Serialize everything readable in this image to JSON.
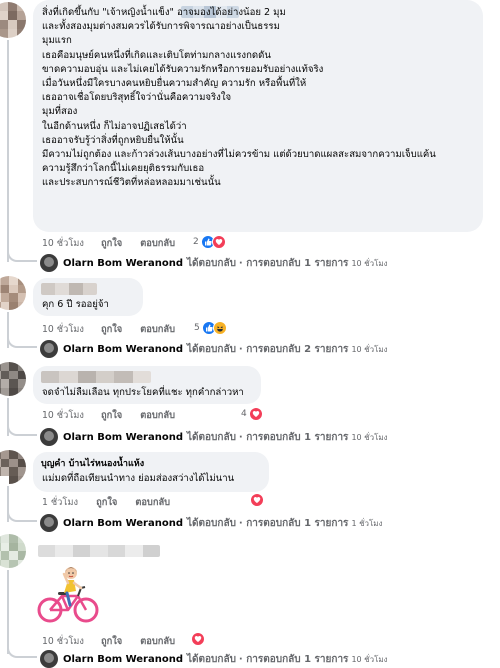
{
  "colors": {
    "bubble": "#f0f2f5",
    "meta_text": "#65676b",
    "like_blue": "#1877f2",
    "heart_red": "#f33e58",
    "haha_yellow": "#f7b125"
  },
  "comments": [
    {
      "lines": [
        "สิ่งที่เกิดขึ้นกับ \"เจ้าหญิงน้ำแข็ง\" อาจมองได้อย่างน้อย 2 มุม",
        "และทั้งสองมุมต่างสมควรได้รับการพิจารณาอย่างเป็นธรรม",
        "",
        "มุมแรก",
        "เธอคือมนุษย์คนหนึ่งที่เกิดและเติบโตท่ามกลางแรงกดดัน",
        "ขาดความอบอุ่น และไม่เคยได้รับความรักหรือการยอมรับอย่างแท้จริง",
        "เมื่อวันหนึ่งมีใครบางคนหยิบยื่นความสำคัญ ความรัก หรือพื้นที่ให้",
        "เธออาจเชื่อโดยบริสุทธิ์ใจว่านั่นคือความจริงใจ",
        "",
        "มุมที่สอง",
        "ในอีกด้านหนึ่ง ก็ไม่อาจปฏิเสธได้ว่า",
        "เธออาจรับรู้ว่าสิ่งที่ถูกหยิบยื่นให้นั้น",
        "มีความไม่ถูกต้อง และก้าวล่วงเส้นบางอย่างที่ไม่ควรข้าม แต่ด้วยบาดแผลสะสมจากความเจ็บแค้น",
        "ความรู้สึกว่าโลกนี้ไม่เคยยุติธรรมกับเธอ",
        "และประสบการณ์ชีวิตที่หล่อหลอมมาเช่นนั้น"
      ],
      "time": "10 ชั่วโมง",
      "like": "ถูกใจ",
      "reply": "ตอบกลับ",
      "reaction_count": "2",
      "reactions": [
        "like-icon",
        "heart-icon"
      ],
      "reply_author": "Olarn Bom Weranond",
      "reply_action": "ได้ตอบกลับ",
      "reply_count": "· การตอบกลับ 1 รายการ",
      "reply_time": "10 ชั่วโมง"
    },
    {
      "lines": [
        "คุก 6 ปี รออยู่จ้า"
      ],
      "time": "10 ชั่วโมง",
      "like": "ถูกใจ",
      "reply": "ตอบกลับ",
      "reaction_count": "5",
      "reactions": [
        "like-icon",
        "haha-icon"
      ],
      "reply_author": "Olarn Bom Weranond",
      "reply_action": "ได้ตอบกลับ",
      "reply_count": "· การตอบกลับ 2 รายการ",
      "reply_time": "10 ชั่วโมง"
    },
    {
      "lines": [
        "จดจำไม่ลืมเลือน ทุกประโยคที่แชะ ทุกคำกล่าวหา"
      ],
      "time": "10 ชั่วโมง",
      "like": "ถูกใจ",
      "reply": "ตอบกลับ",
      "reaction_count": "4",
      "reactions": [
        "heart-icon"
      ],
      "reply_author": "Olarn Bom Weranond",
      "reply_action": "ได้ตอบกลับ",
      "reply_count": "· การตอบกลับ 1 รายการ",
      "reply_time": "10 ชั่วโมง"
    },
    {
      "sender": "บุญคำ บ้านไร่หนองน้ำแห้ง",
      "lines": [
        "แม่มดที่ถือเทียนนำทาง ย่อมส่องสว่างได้ไม่นาน"
      ],
      "time": "1 ชั่วโมง",
      "like": "ถูกใจ",
      "reply": "ตอบกลับ",
      "reactions": [
        "heart-icon"
      ],
      "reply_author": "Olarn Bom Weranond",
      "reply_action": "ได้ตอบกลับ",
      "reply_count": "· การตอบกลับ 1 รายการ",
      "reply_time": "1 ชั่วโมง"
    },
    {
      "sticker": "girl-on-bicycle-sticker",
      "time": "10 ชั่วโมง",
      "like": "ถูกใจ",
      "reply": "ตอบกลับ",
      "reactions": [
        "heart-icon"
      ],
      "reply_author": "Olarn Bom Weranond",
      "reply_action": "ได้ตอบกลับ",
      "reply_count": "· การตอบกลับ 1 รายการ",
      "reply_time": "10 ชั่วโมง"
    }
  ]
}
